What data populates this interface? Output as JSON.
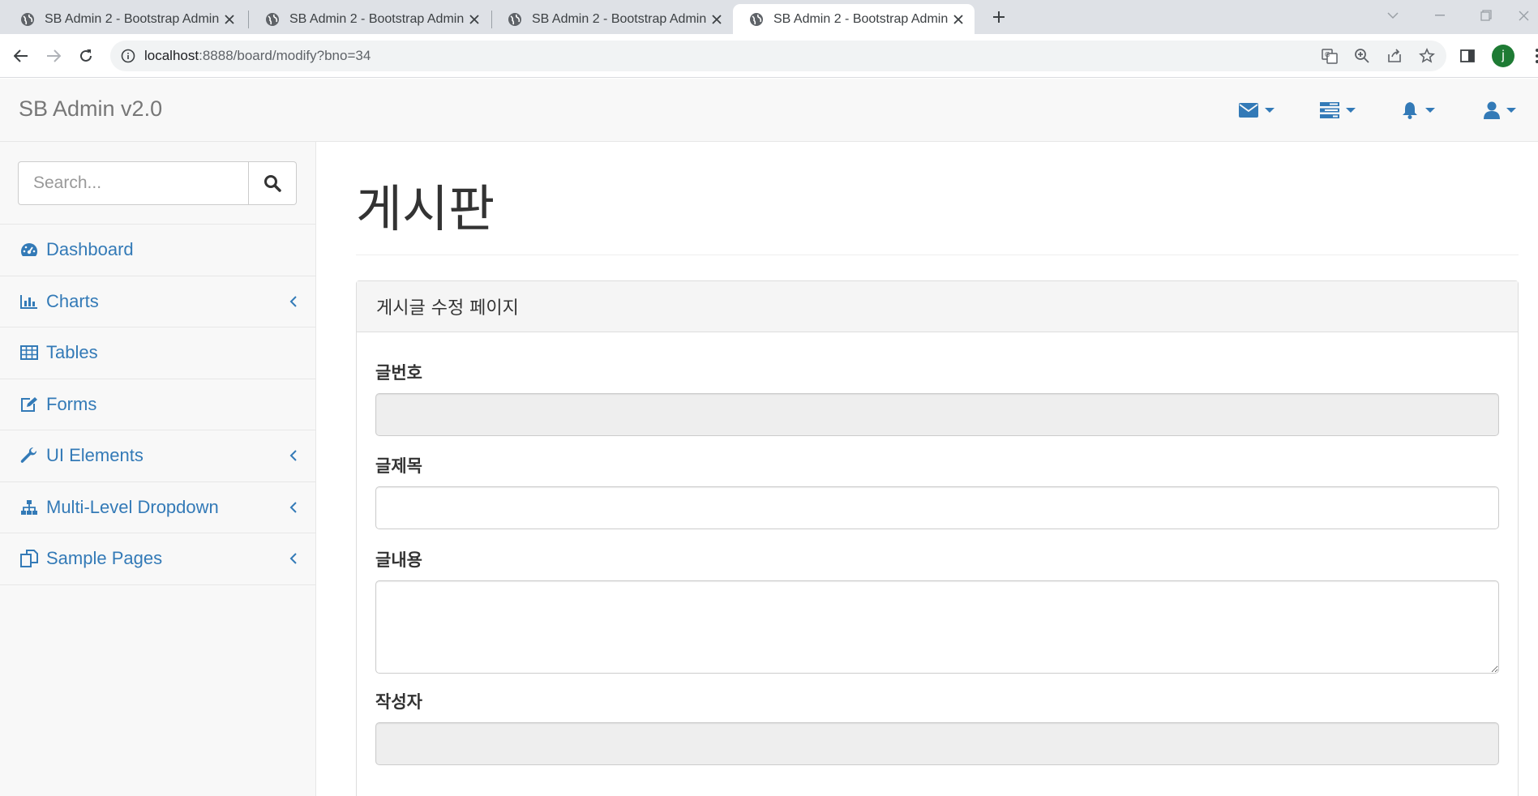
{
  "browser": {
    "tabs": [
      {
        "title": "SB Admin 2 - Bootstrap Admin"
      },
      {
        "title": "SB Admin 2 - Bootstrap Admin"
      },
      {
        "title": "SB Admin 2 - Bootstrap Admin"
      },
      {
        "title": "SB Admin 2 - Bootstrap Admin"
      }
    ],
    "active_tab_index": 3,
    "url_host": "localhost",
    "url_rest": ":8888/board/modify?bno=34",
    "profile_initial": "j"
  },
  "navbar": {
    "brand": "SB Admin v2.0",
    "icons": [
      "envelope-icon",
      "tasks-icon",
      "bell-icon",
      "user-icon"
    ]
  },
  "sidebar": {
    "search": {
      "placeholder": "Search..."
    },
    "items": [
      {
        "label": "Dashboard",
        "icon": "dashboard-icon",
        "has_submenu": false
      },
      {
        "label": "Charts",
        "icon": "bar-chart-icon",
        "has_submenu": true
      },
      {
        "label": "Tables",
        "icon": "table-icon",
        "has_submenu": false
      },
      {
        "label": "Forms",
        "icon": "edit-icon",
        "has_submenu": false
      },
      {
        "label": "UI Elements",
        "icon": "wrench-icon",
        "has_submenu": true
      },
      {
        "label": "Multi-Level Dropdown",
        "icon": "sitemap-icon",
        "has_submenu": true
      },
      {
        "label": "Sample Pages",
        "icon": "files-icon",
        "has_submenu": true
      }
    ]
  },
  "main": {
    "page_title": "게시판",
    "panel": {
      "heading": "게시글 수정 페이지",
      "fields": {
        "bno": {
          "label": "글번호",
          "value": ""
        },
        "title": {
          "label": "글제목",
          "value": ""
        },
        "content": {
          "label": "글내용",
          "value": ""
        },
        "writer": {
          "label": "작성자",
          "value": ""
        }
      }
    }
  },
  "colors": {
    "link": "#337ab7",
    "navbar_bg": "#f8f8f8",
    "border": "#e7e7e7",
    "readonly_bg": "#eeeeee",
    "tabstrip_bg": "#dee1e6"
  }
}
